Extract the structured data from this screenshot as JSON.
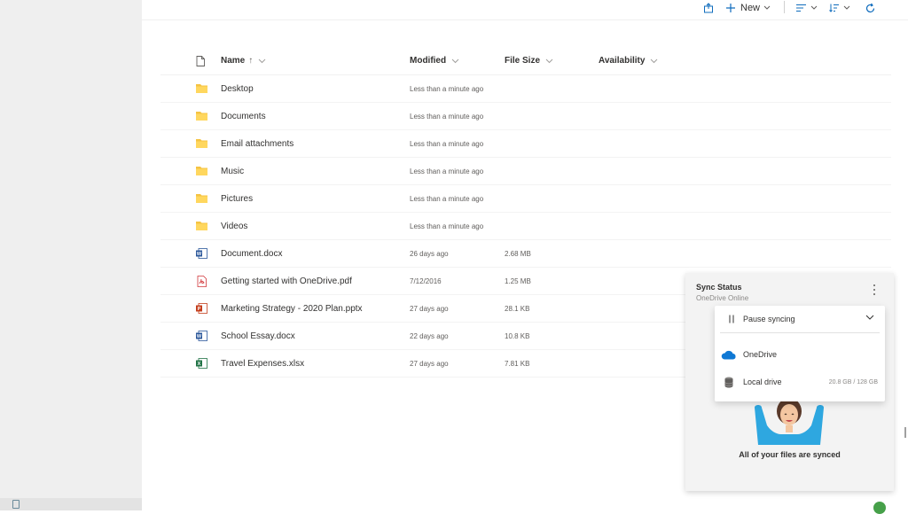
{
  "toolbar": {
    "new_label": "New",
    "icons": [
      "share-icon",
      "plus-icon",
      "view-list-icon",
      "sort-icon",
      "refresh-icon"
    ]
  },
  "table": {
    "headers": {
      "name": "Name",
      "name_sort": "↑",
      "modified": "Modified",
      "size": "File Size",
      "availability": "Availability"
    },
    "rows": [
      {
        "name": "Desktop",
        "modified": "Less than a minute ago",
        "size": "",
        "icon": "folder-icon"
      },
      {
        "name": "Documents",
        "modified": "Less than a minute ago",
        "size": "",
        "icon": "folder-icon"
      },
      {
        "name": "Email attachments",
        "modified": "Less than a minute ago",
        "size": "",
        "icon": "folder-icon"
      },
      {
        "name": "Music",
        "modified": "Less than a minute ago",
        "size": "",
        "icon": "folder-icon"
      },
      {
        "name": "Pictures",
        "modified": "Less than a minute ago",
        "size": "",
        "icon": "folder-icon"
      },
      {
        "name": "Videos",
        "modified": "Less than a minute ago",
        "size": "",
        "icon": "folder-icon"
      },
      {
        "name": "Document.docx",
        "modified": "26 days ago",
        "size": "2.68 MB",
        "icon": "word-icon"
      },
      {
        "name": "Getting started with OneDrive.pdf",
        "modified": "7/12/2016",
        "size": "1.25 MB",
        "icon": "pdf-icon"
      },
      {
        "name": "Marketing Strategy - 2020 Plan.pptx",
        "modified": "27 days ago",
        "size": "28.1 KB",
        "icon": "powerpoint-icon"
      },
      {
        "name": "School Essay.docx",
        "modified": "22 days ago",
        "size": "10.8 KB",
        "icon": "word-icon"
      },
      {
        "name": "Travel Expenses.xlsx",
        "modified": "27 days ago",
        "size": "7.81 KB",
        "icon": "excel-icon"
      }
    ]
  },
  "sync": {
    "title": "Sync Status",
    "subtitle": "OneDrive Online",
    "pause_label": "Pause syncing",
    "onedrive_label": "OneDrive",
    "local_label": "Local drive",
    "local_quota": "20.8 GB / 128 GB",
    "synced_message": "All of your files are synced"
  },
  "colors": {
    "folder": "#f5c342",
    "word": "#2b579a",
    "pdf": "#d13438",
    "powerpoint": "#c43e1c",
    "excel": "#217346",
    "onedrive": "#0f78d4",
    "synced": "#46a049"
  }
}
